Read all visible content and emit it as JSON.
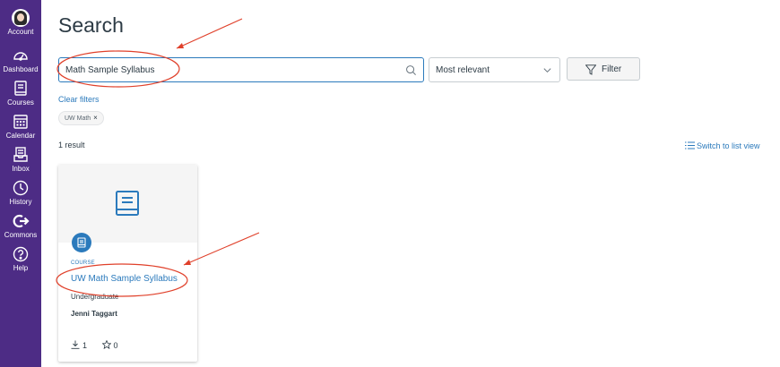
{
  "nav": {
    "items": [
      {
        "label": "Account",
        "icon": "avatar"
      },
      {
        "label": "Dashboard",
        "icon": "dashboard-icon"
      },
      {
        "label": "Courses",
        "icon": "book-icon"
      },
      {
        "label": "Calendar",
        "icon": "calendar-icon"
      },
      {
        "label": "Inbox",
        "icon": "inbox-icon"
      },
      {
        "label": "History",
        "icon": "clock-icon"
      },
      {
        "label": "Commons",
        "icon": "commons-icon"
      },
      {
        "label": "Help",
        "icon": "question-icon"
      }
    ],
    "bg_color": "#4d2c85"
  },
  "page": {
    "title": "Search"
  },
  "search": {
    "value": "Math Sample Syllabus",
    "placeholder": ""
  },
  "sort": {
    "selected": "Most relevant"
  },
  "filter": {
    "label": "Filter"
  },
  "clear_filters": "Clear filters",
  "active_filters": [
    {
      "label": "UW Math"
    }
  ],
  "results": {
    "count_text": "1 result",
    "switch_view": "Switch to list view",
    "items": [
      {
        "type": "COURSE",
        "title": "UW Math Sample Syllabus",
        "level": "Undergraduate",
        "author": "Jenni Taggart",
        "downloads": "1",
        "favorites": "0"
      }
    ]
  },
  "colors": {
    "accent": "#2b7abc",
    "text": "#2d3b45",
    "annotation": "#e0402a"
  }
}
